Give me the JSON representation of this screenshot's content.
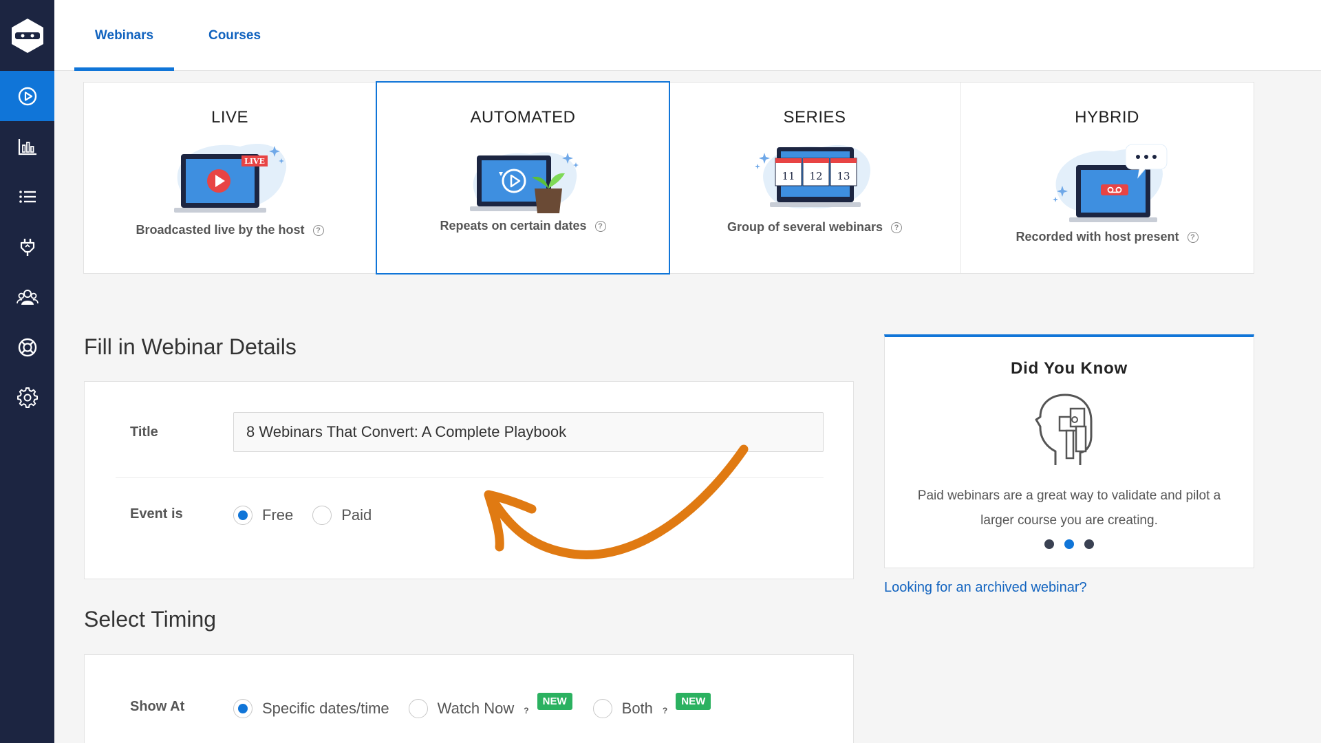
{
  "tabs": [
    {
      "label": "Webinars",
      "active": true
    },
    {
      "label": "Courses",
      "active": false
    }
  ],
  "sidebar": {
    "items": [
      {
        "icon": "play-circle-icon",
        "active": true
      },
      {
        "icon": "bar-chart-icon",
        "active": false
      },
      {
        "icon": "list-icon",
        "active": false
      },
      {
        "icon": "plug-icon",
        "active": false
      },
      {
        "icon": "users-icon",
        "active": false
      },
      {
        "icon": "lifebuoy-icon",
        "active": false
      },
      {
        "icon": "gear-icon",
        "active": false
      }
    ]
  },
  "webinar_types": [
    {
      "title": "LIVE",
      "desc": "Broadcasted live by the host",
      "selected": false,
      "badge": "LIVE"
    },
    {
      "title": "AUTOMATED",
      "desc": "Repeats on certain dates",
      "selected": true
    },
    {
      "title": "SERIES",
      "desc": "Group of several webinars",
      "selected": false,
      "dates": [
        "11",
        "12",
        "13"
      ]
    },
    {
      "title": "HYBRID",
      "desc": "Recorded with host present",
      "selected": false
    }
  ],
  "help_glyph": "?",
  "details": {
    "heading": "Fill in Webinar Details",
    "title_label": "Title",
    "title_value": "8 Webinars That Convert: A Complete Playbook",
    "event_label": "Event is",
    "event_options": [
      {
        "label": "Free",
        "checked": true
      },
      {
        "label": "Paid",
        "checked": false
      }
    ]
  },
  "timing": {
    "heading": "Select Timing",
    "show_at_label": "Show At",
    "options": [
      {
        "label": "Specific dates/time",
        "checked": true
      },
      {
        "label": "Watch Now",
        "checked": false,
        "help": "?",
        "badge": "NEW"
      },
      {
        "label": "Both",
        "checked": false,
        "help": "?",
        "badge": "NEW"
      }
    ]
  },
  "did_you_know": {
    "title": "Did You Know",
    "text": "Paid webinars are a great way to validate and pilot a larger course you are creating.",
    "active_dot": 1,
    "dot_count": 3
  },
  "archived_link": "Looking for an archived webinar?",
  "colors": {
    "sidebar": "#1c2541",
    "accent": "#1075d8",
    "link": "#1163bf",
    "annotation_arrow": "#e07a12",
    "new_badge": "#2bb160"
  }
}
